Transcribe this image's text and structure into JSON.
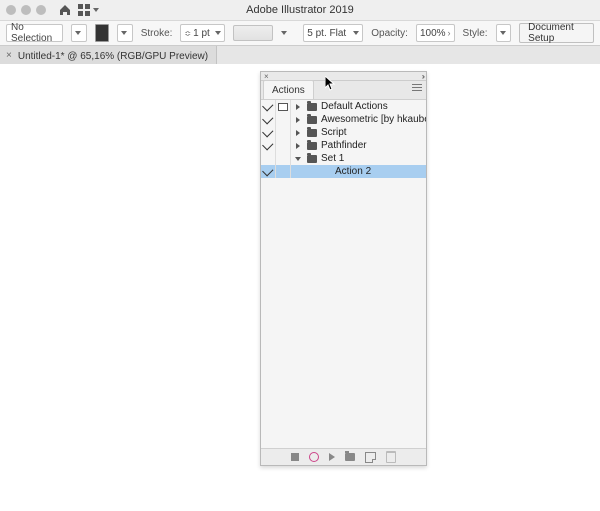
{
  "app": {
    "title": "Adobe Illustrator 2019"
  },
  "controlbar": {
    "selection": "No Selection",
    "stroke_label": "Stroke:",
    "stroke_value": "1 pt",
    "brush_preset": "5 pt. Flat",
    "opacity_label": "Opacity:",
    "opacity_value": "100%",
    "style_label": "Style:",
    "doc_setup": "Document Setup"
  },
  "document": {
    "tab": "Untitled-1* @ 65,16% (RGB/GPU Preview)"
  },
  "panel": {
    "tab": "Actions",
    "rows": [
      {
        "check": true,
        "dialog": true,
        "expand": "right",
        "icon": "folder",
        "label": "Default Actions",
        "indent": 0,
        "selected": false
      },
      {
        "check": true,
        "dialog": false,
        "expand": "right",
        "icon": "folder",
        "label": "Awesometric [by hkaube]",
        "indent": 0,
        "selected": false
      },
      {
        "check": true,
        "dialog": false,
        "expand": "right",
        "icon": "folder",
        "label": "Script",
        "indent": 0,
        "selected": false
      },
      {
        "check": true,
        "dialog": false,
        "expand": "right",
        "icon": "folder",
        "label": "Pathfinder",
        "indent": 0,
        "selected": false
      },
      {
        "check": false,
        "dialog": false,
        "expand": "down",
        "icon": "folder",
        "label": "Set 1",
        "indent": 0,
        "selected": false
      },
      {
        "check": true,
        "dialog": false,
        "expand": "",
        "icon": "",
        "label": "Action 2",
        "indent": 1,
        "selected": true
      }
    ]
  }
}
